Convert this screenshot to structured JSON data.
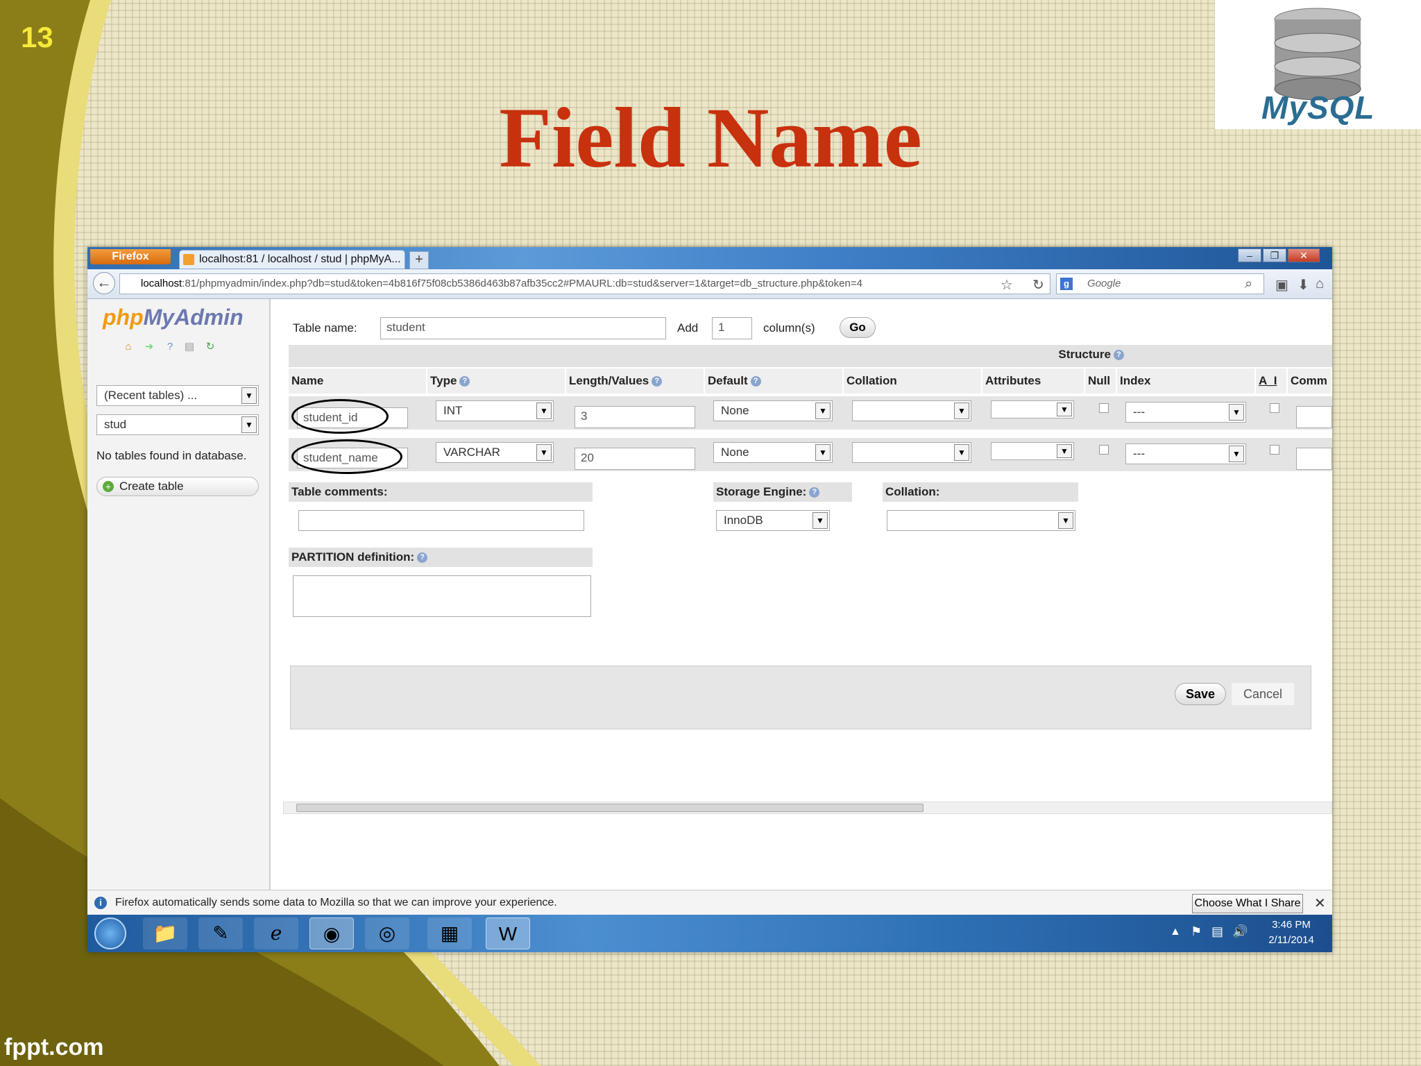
{
  "slide": {
    "number": "13",
    "title": "Field Name",
    "brand_footer": "fppt.com",
    "logo_text": "MySQL"
  },
  "browser": {
    "menu_button": "Firefox",
    "tab_title": "localhost:81 / localhost / stud | phpMyA...",
    "new_tab": "+",
    "window_buttons": {
      "minimize": "–",
      "maximize": "❐",
      "close": "✕"
    },
    "url_host": "localhost",
    "url_rest": ":81/phpmyadmin/index.php?db=stud&token=4b816f75f08cb5386d463b87afb35cc2#PMAURL:db=stud&server=1&target=db_structure.php&token=4",
    "search_placeholder": "Google",
    "search_engine_icon": "g"
  },
  "sidebar": {
    "logo_php": "php",
    "logo_myadmin": "MyAdmin",
    "recent_tables": "(Recent tables) ...",
    "database": "stud",
    "no_tables": "No tables found in database.",
    "create_table": "Create table"
  },
  "form": {
    "table_name_label": "Table name:",
    "table_name_value": "student",
    "add_label": "Add",
    "add_value": "1",
    "columns_label": "column(s)",
    "go_label": "Go",
    "structure_label": "Structure",
    "headers": [
      "Name",
      "Type",
      "Length/Values",
      "Default",
      "Collation",
      "Attributes",
      "Null",
      "Index",
      "A_I",
      "Comm"
    ],
    "rows": [
      {
        "name": "student_id",
        "type": "INT",
        "length": "3",
        "default": "None",
        "collation": "",
        "attributes": "",
        "index": "---"
      },
      {
        "name": "student_name",
        "type": "VARCHAR",
        "length": "20",
        "default": "None",
        "collation": "",
        "attributes": "",
        "index": "---"
      }
    ],
    "table_comments_label": "Table comments:",
    "storage_engine_label": "Storage Engine:",
    "storage_engine_value": "InnoDB",
    "collation_label": "Collation:",
    "collation_value": "",
    "partition_label": "PARTITION definition:",
    "save_label": "Save",
    "cancel_label": "Cancel"
  },
  "notification": {
    "text": "Firefox automatically sends some data to Mozilla so that we can improve your experience.",
    "button": "Choose What I Share",
    "close": "✕"
  },
  "taskbar": {
    "time": "3:46 PM",
    "date": "2/11/2014",
    "apps": [
      "explorer",
      "paint",
      "internet-explorer",
      "firefox",
      "chrome",
      "installer",
      "word"
    ]
  },
  "colors": {
    "title": "#c8310e",
    "slide_number": "#f7e93a",
    "pma_purple": "#6c78af",
    "pma_orange": "#f29a14"
  }
}
